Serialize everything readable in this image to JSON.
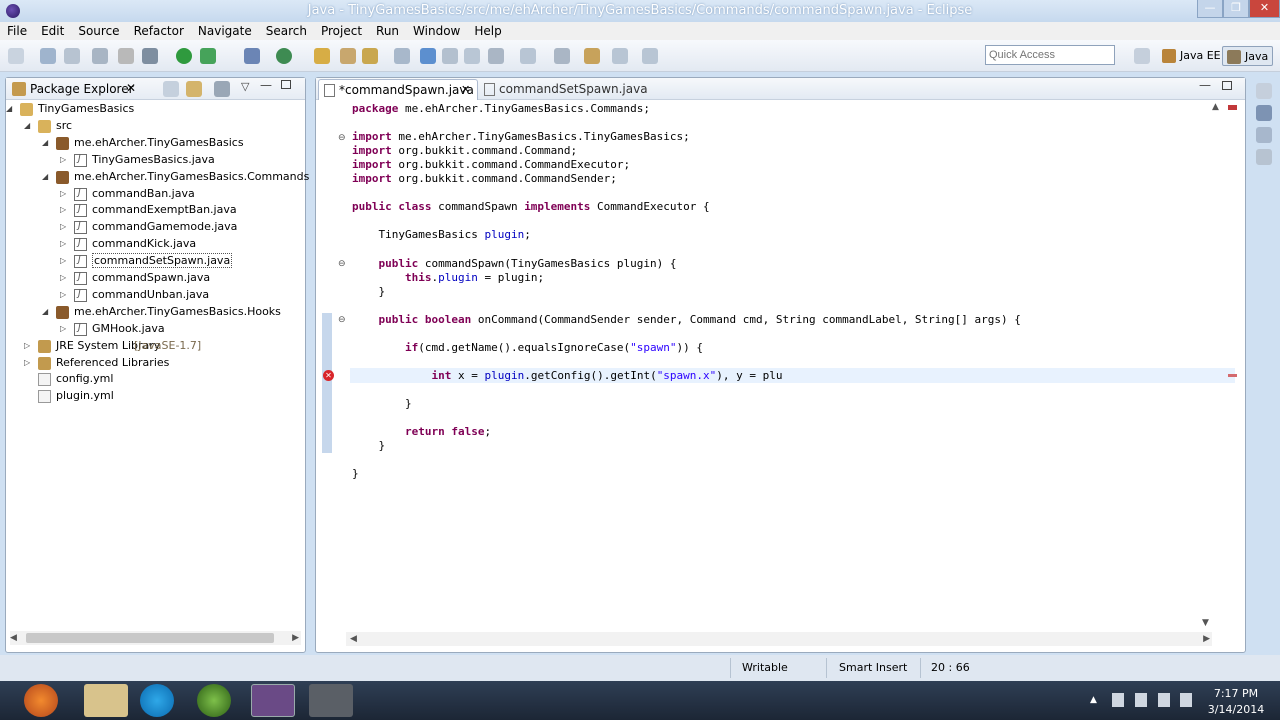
{
  "window": {
    "title": "Java - TinyGamesBasics/src/me/ehArcher/TinyGamesBasics/Commands/commandSpawn.java - Eclipse",
    "min": "—",
    "max": "❐",
    "close": "✕"
  },
  "menu": [
    "File",
    "Edit",
    "Source",
    "Refactor",
    "Navigate",
    "Search",
    "Project",
    "Run",
    "Window",
    "Help"
  ],
  "toolbar": {
    "quick_access_placeholder": "Quick Access",
    "perspectives": [
      "Java EE",
      "Java"
    ]
  },
  "package_explorer": {
    "title": "Package Explorer",
    "tree": [
      {
        "label": "TinyGamesBasics",
        "indent": 0,
        "icon": "project-icon",
        "expanded": true
      },
      {
        "label": "src",
        "indent": 1,
        "icon": "source-folder-icon",
        "expanded": true
      },
      {
        "label": "me.ehArcher.TinyGamesBasics",
        "indent": 2,
        "icon": "package-icon",
        "expanded": true
      },
      {
        "label": "TinyGamesBasics.java",
        "indent": 3,
        "icon": "java-file-icon",
        "expanded": false
      },
      {
        "label": "me.ehArcher.TinyGamesBasics.Commands",
        "indent": 2,
        "icon": "package-icon",
        "expanded": true
      },
      {
        "label": "commandBan.java",
        "indent": 3,
        "icon": "java-file-icon",
        "expanded": false
      },
      {
        "label": "commandExemptBan.java",
        "indent": 3,
        "icon": "java-file-icon",
        "expanded": false
      },
      {
        "label": "commandGamemode.java",
        "indent": 3,
        "icon": "java-file-icon",
        "expanded": false
      },
      {
        "label": "commandKick.java",
        "indent": 3,
        "icon": "java-file-icon",
        "expanded": false
      },
      {
        "label": "commandSetSpawn.java",
        "indent": 3,
        "icon": "java-file-icon",
        "expanded": false,
        "selected": true
      },
      {
        "label": "commandSpawn.java",
        "indent": 3,
        "icon": "java-file-icon",
        "expanded": false
      },
      {
        "label": "commandUnban.java",
        "indent": 3,
        "icon": "java-file-icon",
        "expanded": false
      },
      {
        "label": "me.ehArcher.TinyGamesBasics.Hooks",
        "indent": 2,
        "icon": "package-icon",
        "expanded": true
      },
      {
        "label": "GMHook.java",
        "indent": 3,
        "icon": "java-file-icon",
        "expanded": false
      },
      {
        "label": "JRE System Library",
        "suffix": "[JavaSE-1.7]",
        "indent": 1,
        "icon": "library-icon",
        "expanded": false,
        "collapsed": true
      },
      {
        "label": "Referenced Libraries",
        "indent": 1,
        "icon": "library-icon",
        "expanded": false,
        "collapsed": true
      },
      {
        "label": "config.yml",
        "indent": 1,
        "icon": "yml-file-icon",
        "expanded": false
      },
      {
        "label": "plugin.yml",
        "indent": 1,
        "icon": "yml-file-icon",
        "expanded": false
      }
    ]
  },
  "editor": {
    "tabs": [
      {
        "label": "*commandSpawn.java",
        "active": true
      },
      {
        "label": "commandSetSpawn.java",
        "active": false
      }
    ],
    "code_lines": [
      [
        {
          "t": "package ",
          "c": "kw"
        },
        {
          "t": "me.ehArcher.TinyGamesBasics.Commands;"
        }
      ],
      [],
      [
        {
          "t": "import ",
          "c": "kw"
        },
        {
          "t": "me.ehArcher.TinyGamesBasics.TinyGamesBasics;"
        }
      ],
      [
        {
          "t": "import ",
          "c": "kw"
        },
        {
          "t": "org.bukkit.command.Command;"
        }
      ],
      [
        {
          "t": "import ",
          "c": "kw"
        },
        {
          "t": "org.bukkit.command.CommandExecutor;"
        }
      ],
      [
        {
          "t": "import ",
          "c": "kw"
        },
        {
          "t": "org.bukkit.command.CommandSender;"
        }
      ],
      [],
      [
        {
          "t": "public class ",
          "c": "kw"
        },
        {
          "t": "commandSpawn "
        },
        {
          "t": "implements ",
          "c": "kw"
        },
        {
          "t": "CommandExecutor {"
        }
      ],
      [],
      [
        {
          "t": "    TinyGamesBasics "
        },
        {
          "t": "plugin",
          "c": "fld"
        },
        {
          "t": ";"
        }
      ],
      [],
      [
        {
          "t": "    "
        },
        {
          "t": "public ",
          "c": "kw"
        },
        {
          "t": "commandSpawn(TinyGamesBasics plugin) {"
        }
      ],
      [
        {
          "t": "        "
        },
        {
          "t": "this",
          "c": "kw"
        },
        {
          "t": "."
        },
        {
          "t": "plugin",
          "c": "fld"
        },
        {
          "t": " = plugin;"
        }
      ],
      [
        {
          "t": "    }"
        }
      ],
      [],
      [
        {
          "t": "    "
        },
        {
          "t": "public boolean ",
          "c": "kw"
        },
        {
          "t": "onCommand(CommandSender sender, Command cmd, String commandLabel, String[] args) {"
        }
      ],
      [],
      [
        {
          "t": "        "
        },
        {
          "t": "if",
          "c": "kw"
        },
        {
          "t": "(cmd.getName().equalsIgnoreCase("
        },
        {
          "t": "\"spawn\"",
          "c": "str"
        },
        {
          "t": ")) {"
        }
      ],
      [],
      [
        {
          "t": "            "
        },
        {
          "t": "int ",
          "c": "kw"
        },
        {
          "t": "x = "
        },
        {
          "t": "plugin",
          "c": "fld"
        },
        {
          "t": ".getConfig().getInt("
        },
        {
          "t": "\"spawn.x\"",
          "c": "str"
        },
        {
          "t": "), y = plu"
        }
      ],
      [],
      [
        {
          "t": "        }"
        }
      ],
      [],
      [
        {
          "t": "        "
        },
        {
          "t": "return false",
          "c": "kw"
        },
        {
          "t": ";"
        }
      ],
      [
        {
          "t": "    }"
        }
      ],
      [],
      [
        {
          "t": "}"
        }
      ]
    ]
  },
  "status": {
    "mode": "Writable",
    "insert": "Smart Insert",
    "position": "20 : 66"
  },
  "taskbar": {
    "time": "7:17 PM",
    "date": "3/14/2014"
  }
}
